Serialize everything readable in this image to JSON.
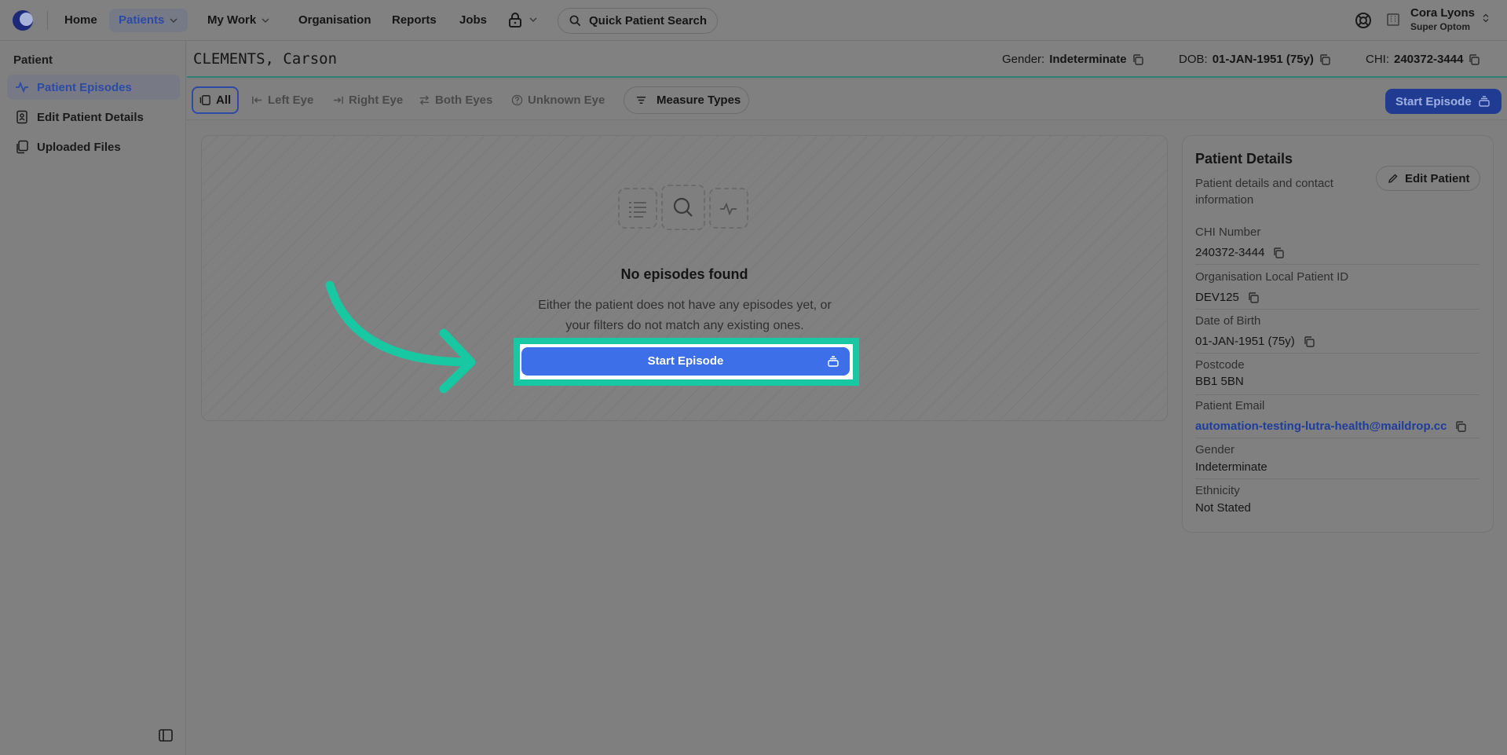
{
  "nav": {
    "home": "Home",
    "patients": "Patients",
    "my_work": "My Work",
    "organisation": "Organisation",
    "reports": "Reports",
    "jobs": "Jobs",
    "search": "Quick Patient Search"
  },
  "user": {
    "name": "Cora Lyons",
    "role": "Super Optom"
  },
  "sidebar": {
    "heading": "Patient",
    "items": [
      {
        "label": "Patient Episodes",
        "icon": "activity-icon"
      },
      {
        "label": "Edit Patient Details",
        "icon": "id-card-icon"
      },
      {
        "label": "Uploaded Files",
        "icon": "files-icon"
      }
    ]
  },
  "patient": {
    "name": "CLEMENTS, Carson",
    "gender_label": "Gender:",
    "gender": "Indeterminate",
    "dob_label": "DOB:",
    "dob": "01-JAN-1951 (75y)",
    "chi_label": "CHI:",
    "chi": "240372-3444"
  },
  "filters": {
    "all": "All",
    "left_eye": "Left Eye",
    "right_eye": "Right Eye",
    "both_eyes": "Both Eyes",
    "unknown_eye": "Unknown Eye",
    "measure_types": "Measure Types",
    "start_episode": "Start Episode"
  },
  "empty": {
    "title": "No episodes found",
    "desc_line1": "Either the patient does not have any episodes yet, or",
    "desc_line2": "your filters do not match any existing ones.",
    "button": "Start Episode"
  },
  "details": {
    "title": "Patient Details",
    "subtitle": "Patient details and contact information",
    "edit": "Edit Patient",
    "fields": [
      {
        "label": "CHI Number",
        "value": "240372-3444"
      },
      {
        "label": "Organisation Local Patient ID",
        "value": "DEV125"
      },
      {
        "label": "Date of Birth",
        "value": "01-JAN-1951 (75y)"
      },
      {
        "label": "Postcode",
        "value": "BB1 5BN"
      },
      {
        "label": "Patient Email",
        "value": "automation-testing-lutra-health@maildrop.cc"
      },
      {
        "label": "Gender",
        "value": "Indeterminate"
      },
      {
        "label": "Ethnicity",
        "value": "Not Stated"
      }
    ]
  },
  "colors": {
    "accent": "#3d6fe8",
    "highlight": "#17c8a2",
    "link": "#1e3d9c"
  }
}
